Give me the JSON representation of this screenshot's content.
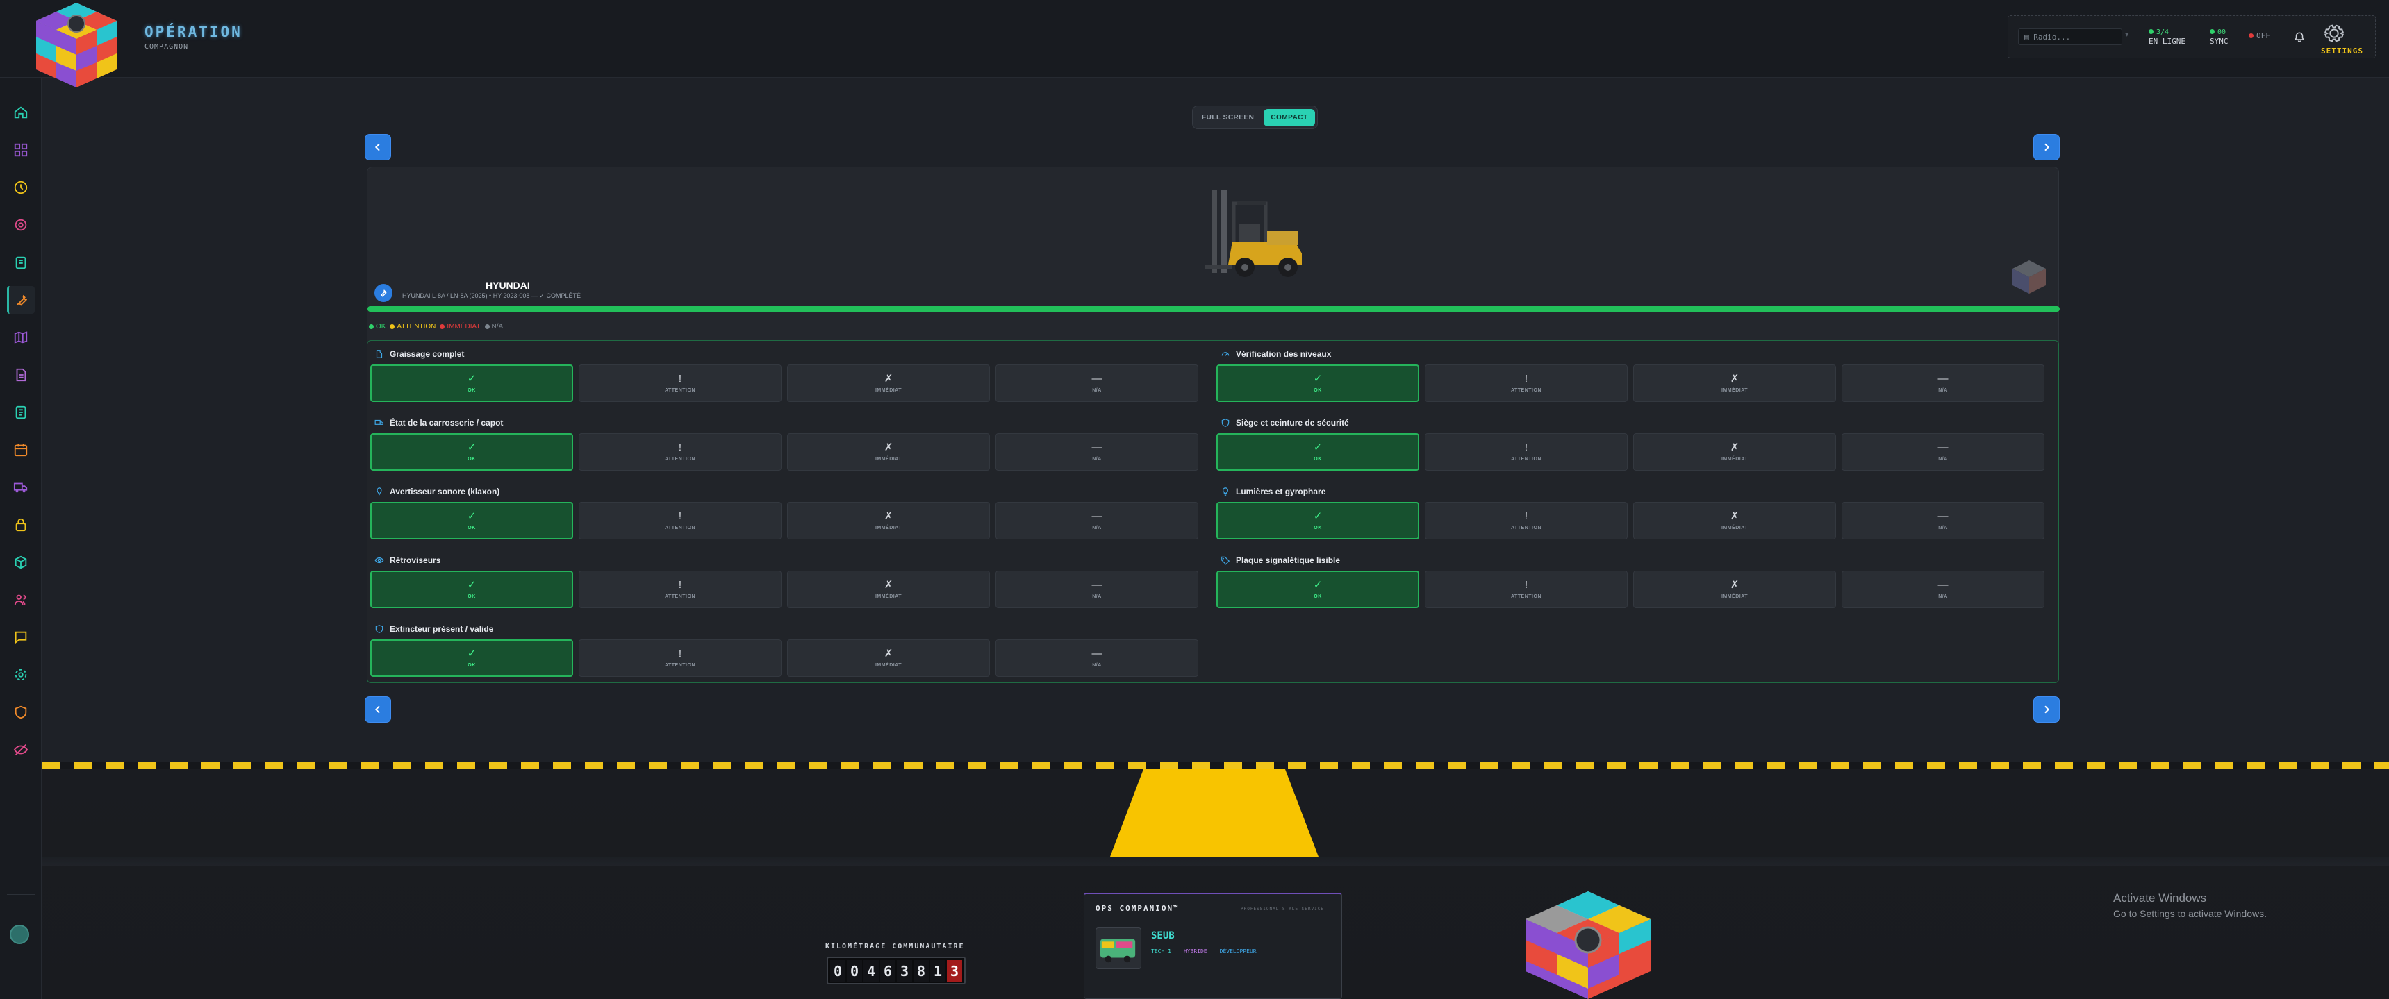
{
  "brand": {
    "title": "OPÉRATION",
    "subtitle": "COMPAGNON"
  },
  "status": {
    "radio_placeholder": "Radio...",
    "online_count": "3/4",
    "online_label": "EN LIGNE",
    "sync_count": "00",
    "sync_label": "SYNC",
    "off_label": "OFF",
    "settings_label": "SETTINGS"
  },
  "sidebar": {
    "items": [
      {
        "icon": "home-icon"
      },
      {
        "icon": "dashboard-icon"
      },
      {
        "icon": "clock-icon"
      },
      {
        "icon": "target-icon"
      },
      {
        "icon": "clipboard-icon"
      },
      {
        "icon": "wrench-icon",
        "active": true
      },
      {
        "icon": "map-icon"
      },
      {
        "icon": "document-icon"
      },
      {
        "icon": "report-icon"
      },
      {
        "icon": "calendar-icon"
      },
      {
        "icon": "truck-icon"
      },
      {
        "icon": "lock-icon"
      },
      {
        "icon": "cube-icon"
      },
      {
        "icon": "users-icon"
      },
      {
        "icon": "chat-icon"
      },
      {
        "icon": "settings-icon"
      },
      {
        "icon": "shield-icon"
      },
      {
        "icon": "eye-off-icon"
      }
    ]
  },
  "view": {
    "full_screen": "FULL SCREEN",
    "compact": "COMPACT",
    "active": "compact"
  },
  "vehicle": {
    "make": "HYUNDAI",
    "meta": "HYUNDAI L-8A / LN-8A (2025) • HY-2023-008 — ✓ COMPLÉTÉ",
    "progress": 1.0
  },
  "legend": [
    {
      "label": "OK",
      "color": "#2fd06a"
    },
    {
      "label": "ATTENTION",
      "color": "#f0c419"
    },
    {
      "label": "IMMÉDIAT",
      "color": "#e03b3b"
    },
    {
      "label": "N/A",
      "color": "#7d868f"
    }
  ],
  "options": {
    "ok": {
      "symbol": "✓",
      "label": "OK"
    },
    "attention": {
      "symbol": "!",
      "label": "ATTENTION"
    },
    "immediate": {
      "symbol": "✗",
      "label": "IMMÉDIAT"
    },
    "na": {
      "symbol": "—",
      "label": "N/A"
    }
  },
  "checklist": [
    {
      "title": "Graissage complet",
      "icon": "grease-icon",
      "selected": "ok"
    },
    {
      "title": "Vérification des niveaux",
      "icon": "gauge-icon",
      "selected": "ok"
    },
    {
      "title": "État de la carrosserie / capot",
      "icon": "truck-icon",
      "selected": "ok"
    },
    {
      "title": "Siège et ceinture de sécurité",
      "icon": "shield-icon",
      "selected": "ok"
    },
    {
      "title": "Avertisseur sonore (klaxon)",
      "icon": "horn-icon",
      "selected": "ok"
    },
    {
      "title": "Lumières et gyrophare",
      "icon": "bulb-icon",
      "selected": "ok"
    },
    {
      "title": "Rétroviseurs",
      "icon": "eye-icon",
      "selected": "ok"
    },
    {
      "title": "Plaque signalétique lisible",
      "icon": "tag-icon",
      "selected": "ok"
    },
    {
      "title": "Extincteur présent / valide",
      "icon": "extinguisher-icon",
      "selected": "ok"
    }
  ],
  "odometer": {
    "label": "KILOMÉTRAGE COMMUNAUTAIRE",
    "digits": [
      "0",
      "0",
      "4",
      "6",
      "3",
      "8",
      "1",
      "3"
    ]
  },
  "companion": {
    "title": "OPS COMPANION™",
    "subtitle": "PROFESSIONAL STYLE SERVICE",
    "name": "SEUB",
    "tags": [
      "TECH 1",
      "HYBRIDE",
      "DÉVELOPPEUR"
    ]
  },
  "windows": {
    "line1": "Activate Windows",
    "line2": "Go to Settings to activate Windows."
  },
  "colors": {
    "accent": "#2ad1b3",
    "ok": "#25b45b",
    "nav": "#2b7de0",
    "hazard": "#f0c419"
  }
}
